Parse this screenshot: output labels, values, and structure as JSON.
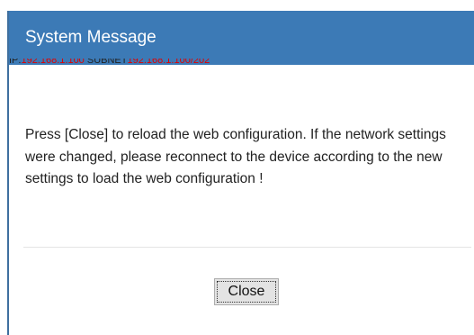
{
  "dialog": {
    "title": "System Message",
    "clipped_line_a": "IP:",
    "clipped_line_b": "192.168.1.100 ",
    "clipped_line_c": "SUBNET",
    "clipped_line_d": "192.168.1.100/202",
    "message": "Press [Close] to reload the web configuration. If the network settings were changed, please reconnect to the device according to the new settings to load the web configuration !",
    "close_label": "Close"
  },
  "colors": {
    "titlebar": "#3c7ab6",
    "title_text": "#ffffff",
    "clipped_text": "#e00000"
  }
}
